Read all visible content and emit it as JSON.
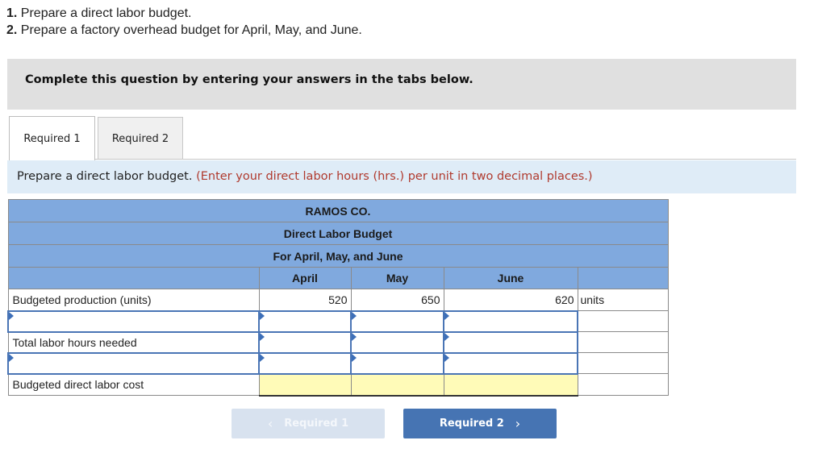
{
  "instructions": [
    {
      "number": "1.",
      "text": "Prepare a direct labor budget."
    },
    {
      "number": "2.",
      "text": "Prepare a factory overhead budget for April, May, and June."
    }
  ],
  "banner": "Complete this question by entering your answers in the tabs below.",
  "tabs": [
    {
      "label": "Required 1",
      "active": true
    },
    {
      "label": "Required 2",
      "active": false
    }
  ],
  "prompt": {
    "main": "Prepare a direct labor budget.",
    "note": "(Enter your direct labor hours (hrs.) per unit in two decimal places.)"
  },
  "table": {
    "company": "RAMOS CO.",
    "title": "Direct Labor Budget",
    "period": "For April, May, and June",
    "columns": [
      "April",
      "May",
      "June"
    ],
    "rows": [
      {
        "label": "Budgeted production (units)",
        "values": [
          "520",
          "650",
          "620"
        ],
        "unit": "units"
      },
      {
        "label": "",
        "values": [
          "",
          "",
          ""
        ],
        "unit": "",
        "input": true
      },
      {
        "label": "Total labor hours needed",
        "values": [
          "",
          "",
          ""
        ],
        "unit": ""
      },
      {
        "label": "",
        "values": [
          "",
          "",
          ""
        ],
        "unit": "",
        "input": true
      },
      {
        "label": "Budgeted direct labor cost",
        "values": [
          "",
          "",
          ""
        ],
        "unit": ""
      }
    ]
  },
  "nav": {
    "prev_label": "Required 1",
    "next_label": "Required 2",
    "prev_icon": "chevron-left-icon",
    "next_icon": "chevron-right-icon"
  }
}
